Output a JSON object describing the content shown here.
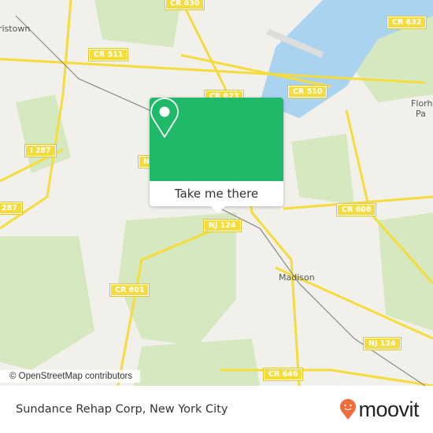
{
  "map": {
    "road_labels": [
      "CR 630",
      "CR 632",
      "CR 511",
      "CR 510",
      "CR 623",
      "I 287",
      "287",
      "NJ 124",
      "CR 608",
      "CR 601",
      "NJ 124",
      "CR 646",
      "N"
    ],
    "place_labels": [
      "ristown",
      "Florh",
      "Pa",
      "Madison"
    ],
    "attribution": "© OpenStreetMap contributors",
    "colors": {
      "land": "#f1f0ea",
      "park": "#d6e8c0",
      "water": "#a9d3ef",
      "road": "#f5dc3c"
    }
  },
  "popup": {
    "icon": "map-pin-icon",
    "button_label": "Take me there",
    "color": "#1fb969"
  },
  "footer": {
    "title": "Sundance Rehap Corp, New York City",
    "logo_text": "moovit",
    "logo_color": "#f26b3a"
  }
}
